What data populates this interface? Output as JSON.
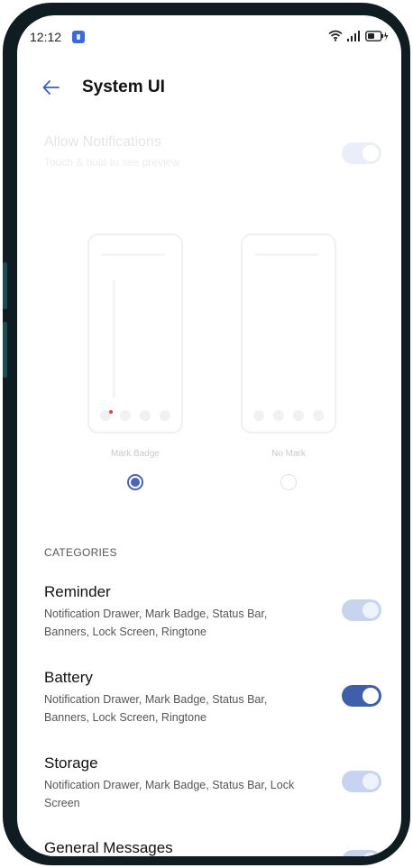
{
  "status_bar": {
    "time": "12:12",
    "icons": [
      "app-notification-icon",
      "wifi-icon",
      "signal-icon",
      "battery-charging-icon"
    ]
  },
  "header": {
    "title": "System UI",
    "back_icon": "arrow-left-icon"
  },
  "allow_notifications": {
    "title": "Allow Notifications",
    "subtitle": "Touch & hold to see preview",
    "enabled": true
  },
  "badge_options": [
    {
      "label": "Mark Badge",
      "selected": true
    },
    {
      "label": "No Mark",
      "selected": false
    }
  ],
  "categories_header": "CATEGORIES",
  "categories": [
    {
      "title": "Reminder",
      "subtitle": "Notification Drawer, Mark Badge, Status Bar, Banners, Lock Screen, Ringtone",
      "enabled": true,
      "toggle_disabled": true
    },
    {
      "title": "Battery",
      "subtitle": "Notification Drawer, Mark Badge, Status Bar, Banners, Lock Screen, Ringtone",
      "enabled": true,
      "toggle_disabled": false
    },
    {
      "title": "Storage",
      "subtitle": "Notification Drawer, Mark Badge, Status Bar, Lock Screen",
      "enabled": true,
      "toggle_disabled": true
    },
    {
      "title": "General Messages",
      "subtitle": "",
      "enabled": true,
      "toggle_disabled": true
    }
  ],
  "colors": {
    "accent": "#3f5fa8",
    "toggle_disabled": "#c8d4ef",
    "frame": "#0f1d22"
  }
}
